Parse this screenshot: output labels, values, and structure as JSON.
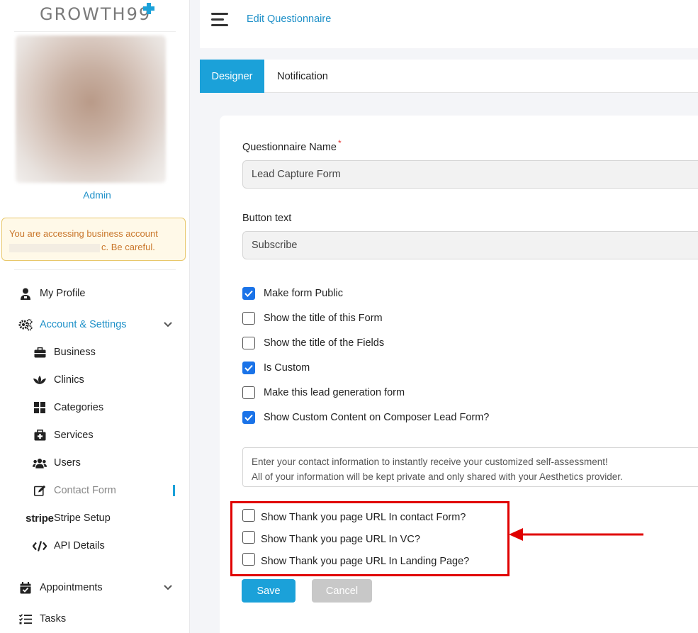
{
  "brand": {
    "logo_text": "GROWTH99",
    "logo_badge": "PLUS",
    "accent_color": "#1ba1d9"
  },
  "sidebar": {
    "user_name": "Admin",
    "warning": {
      "line1": "You are accessing business account",
      "line2_suffix": "c. Be careful."
    },
    "items": [
      {
        "label": "My Profile",
        "icon": "user-icon"
      },
      {
        "label": "Account & Settings",
        "icon": "gears-icon",
        "expanded": true
      },
      {
        "label": "Business",
        "icon": "briefcase-icon"
      },
      {
        "label": "Clinics",
        "icon": "lotus-icon"
      },
      {
        "label": "Categories",
        "icon": "grid-icon"
      },
      {
        "label": "Services",
        "icon": "medical-bag-icon"
      },
      {
        "label": "Users",
        "icon": "users-icon"
      },
      {
        "label": "Contact Form",
        "icon": "edit-icon",
        "active": true
      },
      {
        "label": "Stripe Setup",
        "icon": "stripe-icon",
        "icon_text": "stripe"
      },
      {
        "label": "API Details",
        "icon": "code-icon"
      },
      {
        "label": "Appointments",
        "icon": "calendar-icon"
      },
      {
        "label": "Tasks",
        "icon": "tasks-icon"
      }
    ]
  },
  "header": {
    "title": "Edit Questionnaire"
  },
  "tabs": [
    {
      "label": "Designer",
      "active": true
    },
    {
      "label": "Notification",
      "active": false
    }
  ],
  "form": {
    "name_label": "Questionnaire Name",
    "required_mark": "*",
    "name_value": "Lead Capture Form",
    "button_text_label": "Button text",
    "button_text_value": "Subscribe",
    "options": [
      {
        "label": "Make form Public",
        "checked": true
      },
      {
        "label": "Show the title of this Form",
        "checked": false
      },
      {
        "label": "Show the title of the Fields",
        "checked": false
      },
      {
        "label": "Is Custom",
        "checked": true
      },
      {
        "label": "Make this lead generation form",
        "checked": false
      },
      {
        "label": "Show Custom Content on Composer Lead Form?",
        "checked": true
      }
    ],
    "custom_content": {
      "line1": "Enter your contact information to instantly receive your customized self-assessment!",
      "line2": "All of your information will be kept private and only shared with your Aesthetics provider."
    },
    "thank_you_options": [
      {
        "label": "Show Thank you page URL In contact Form?",
        "checked": false
      },
      {
        "label": "Show Thank you page URL In VC?",
        "checked": false
      },
      {
        "label": "Show Thank you page URL In Landing Page?",
        "checked": false
      }
    ],
    "save_label": "Save",
    "cancel_label": "Cancel"
  },
  "annotation_color": "#e00000"
}
